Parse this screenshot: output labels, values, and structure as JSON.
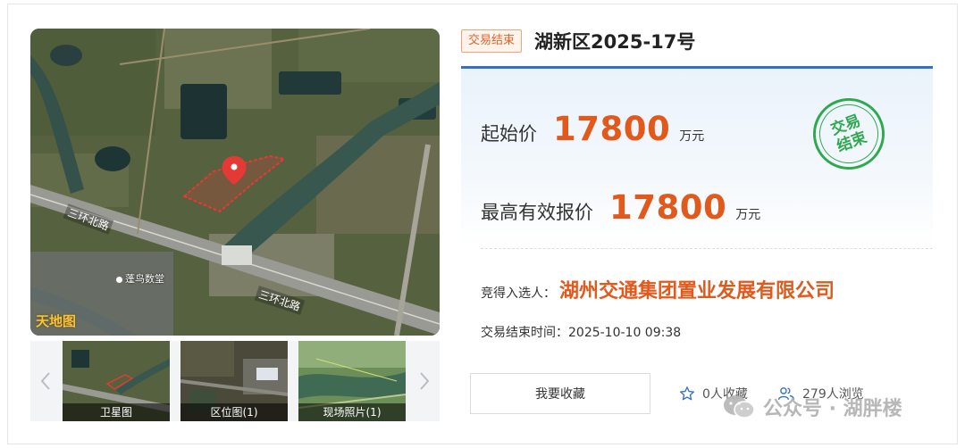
{
  "map": {
    "logo_text": "天地图",
    "road_labels": [
      "三环北路",
      "三环北路"
    ],
    "poi_label": "蓬鸟数堂"
  },
  "thumbnails": [
    {
      "caption": "卫星图"
    },
    {
      "caption": "区位图(1)"
    },
    {
      "caption": "现场照片(1)"
    }
  ],
  "listing": {
    "status_tag": "交易结束",
    "title": "湖新区2025-17号",
    "stamp_text": "交易结束",
    "start_price_label": "起始价",
    "start_price_value": "17800",
    "start_price_unit": "万元",
    "highest_price_label": "最高有效报价",
    "highest_price_value": "17800",
    "highest_price_unit": "万元",
    "winner_label": "竞得入选人：",
    "winner_name": "湖州交通集团置业发展有限公司",
    "end_time_label": "交易结束时间：",
    "end_time_value": "2025-10-10 09:38"
  },
  "actions": {
    "favorite_button": "我要收藏",
    "favorites_count": "0人收藏",
    "views_count": "279人浏览"
  },
  "watermark": {
    "text": "公众号 · 湖胖楼"
  },
  "colors": {
    "accent_blue": "#3570c3",
    "price_orange": "#e2591c",
    "stamp_green": "#2fa84f",
    "tag_orange": "#e2632a"
  },
  "icons": {
    "star": "star-icon",
    "users": "users-icon",
    "chevron_left": "chevron-left-icon",
    "chevron_right": "chevron-right-icon",
    "map_pin": "map-pin-icon",
    "wechat": "wechat-icon"
  }
}
